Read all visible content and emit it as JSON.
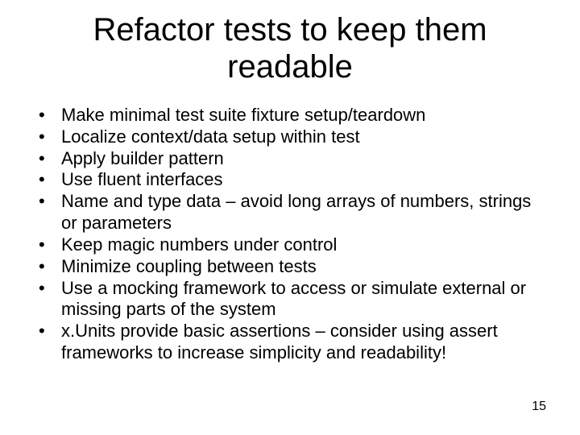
{
  "title": "Refactor tests to keep them readable",
  "bullets": [
    "Make minimal test suite fixture setup/teardown",
    "Localize context/data setup within test",
    "Apply builder pattern",
    "Use fluent interfaces",
    "Name and type data – avoid long arrays of numbers, strings or parameters",
    "Keep magic numbers under control",
    "Minimize coupling between tests",
    "Use a mocking framework to access or simulate external or missing parts of the system",
    "x.Units provide basic assertions – consider using assert frameworks to increase simplicity and readability!"
  ],
  "page_number": "15",
  "bullet_char": "•"
}
